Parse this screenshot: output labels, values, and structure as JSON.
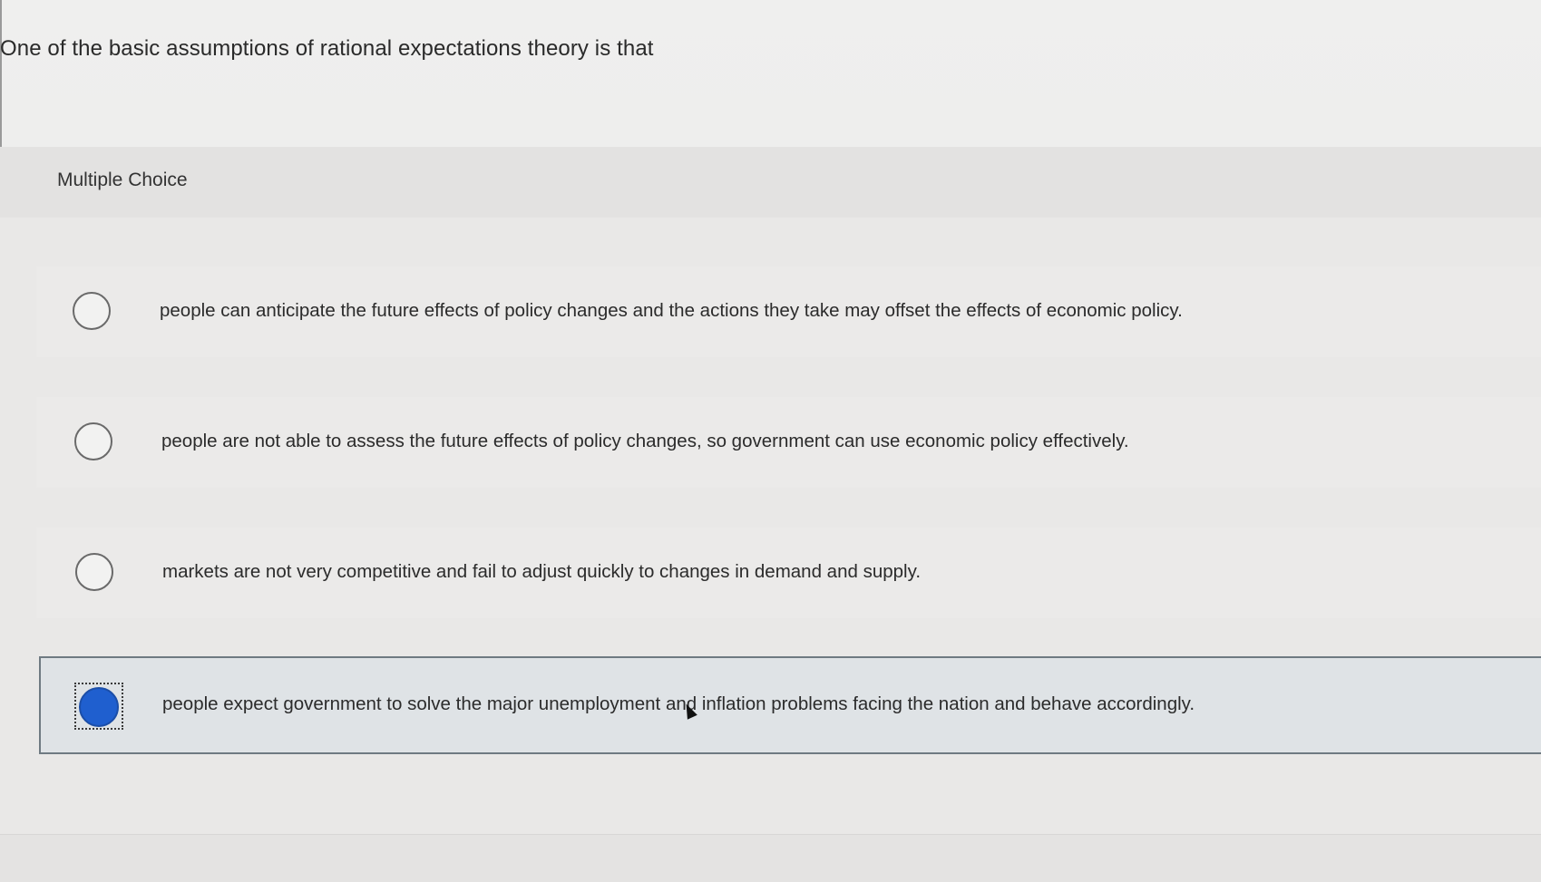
{
  "question": {
    "text": "One of the basic assumptions of rational expectations theory is that"
  },
  "section": {
    "label": "Multiple Choice"
  },
  "options": [
    {
      "text": "people can anticipate the future effects of policy changes and the actions they take may offset the effects of economic policy.",
      "selected": false
    },
    {
      "text": "people are not able to assess the future effects of policy changes, so government can use economic policy effectively.",
      "selected": false
    },
    {
      "text": "markets are not very competitive and fail to adjust quickly to changes in demand and supply.",
      "selected": false
    },
    {
      "text": "people expect government to solve the major unemployment and inflation problems facing the nation and behave accordingly.",
      "selected": true
    }
  ],
  "colors": {
    "selected_radio": "#1f5fcf",
    "selected_border": "#6f7a82"
  },
  "icons": {
    "cursor": "mouse-pointer-icon"
  }
}
